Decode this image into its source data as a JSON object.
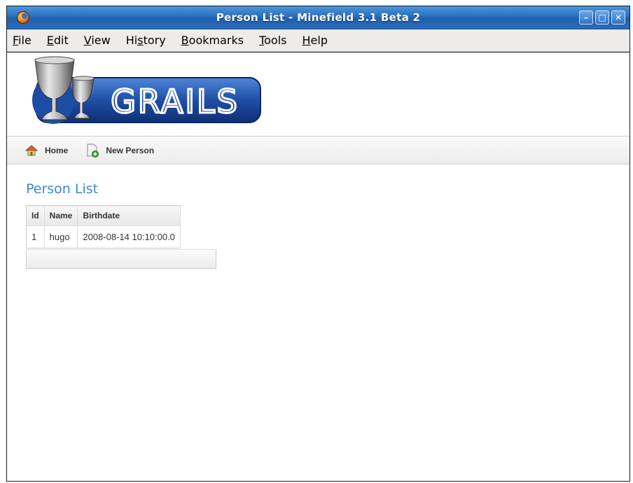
{
  "window": {
    "title": "Person List - Minefield 3.1 Beta 2",
    "controls": {
      "minimize": "–",
      "maximize": "□",
      "close": "✕"
    }
  },
  "menubar": {
    "items": [
      {
        "accel": "F",
        "rest": "ile"
      },
      {
        "accel": "E",
        "rest": "dit"
      },
      {
        "accel": "V",
        "rest": "iew"
      },
      {
        "pre": "Hi",
        "accel": "s",
        "rest": "tory"
      },
      {
        "accel": "B",
        "rest": "ookmarks"
      },
      {
        "accel": "T",
        "rest": "ools"
      },
      {
        "accel": "H",
        "rest": "elp"
      }
    ]
  },
  "logo": {
    "text": "GRAILS"
  },
  "nav": {
    "home": "Home",
    "new_person": "New Person"
  },
  "page": {
    "heading": "Person List"
  },
  "table": {
    "headers": [
      "Id",
      "Name",
      "Birthdate"
    ],
    "rows": [
      [
        "1",
        "hugo",
        "2008-08-14 10:10:00.0"
      ]
    ]
  },
  "colors": {
    "accent": "#3a89d0",
    "titlebar": "#2a6fc0"
  }
}
